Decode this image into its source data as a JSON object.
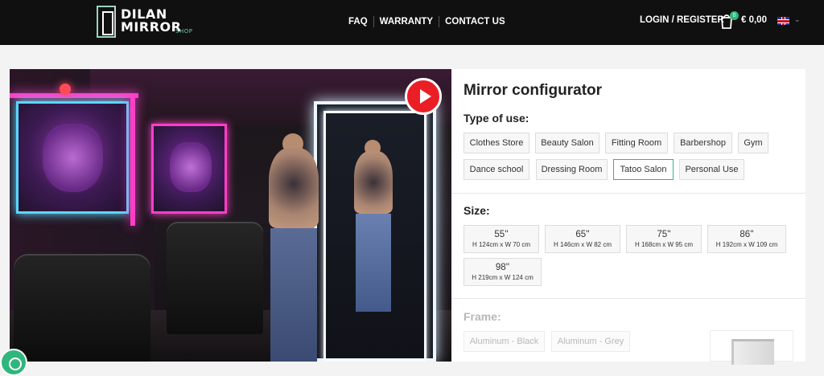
{
  "header": {
    "logo_line1": "DILAN",
    "logo_line2": "MIRROR",
    "logo_shop": "SHOP",
    "nav": [
      "FAQ",
      "WARRANTY",
      "CONTACT US"
    ],
    "login": "LOGIN / REGISTER",
    "cart_count": "0",
    "cart_total": "€ 0,00",
    "language_icon": "uk-flag-icon"
  },
  "hero": {
    "play_icon": "play-icon"
  },
  "configurator": {
    "title": "Mirror configurator",
    "type_label": "Type of use:",
    "types": [
      "Clothes Store",
      "Beauty Salon",
      "Fitting Room",
      "Barbershop",
      "Gym",
      "Dance school",
      "Dressing Room",
      "Tatoo Salon",
      "Personal Use"
    ],
    "selected_type": "Tatoo Salon",
    "size_label": "Size:",
    "sizes": [
      {
        "name": "55''",
        "dims": "H 124cm x W 70 cm"
      },
      {
        "name": "65''",
        "dims": "H 146cm x W 82 cm"
      },
      {
        "name": "75''",
        "dims": "H 168cm x W 95 cm"
      },
      {
        "name": "86''",
        "dims": "H 192cm x W 109 cm"
      },
      {
        "name": "98''",
        "dims": "H 219cm x W 124 cm"
      }
    ],
    "frame_label": "Frame:",
    "frames": [
      "Aluminum - Black",
      "Aluminum - Grey"
    ]
  },
  "colors": {
    "accent": "#2fb67c",
    "header_bg": "#101010",
    "play_red": "#ea1f26"
  }
}
